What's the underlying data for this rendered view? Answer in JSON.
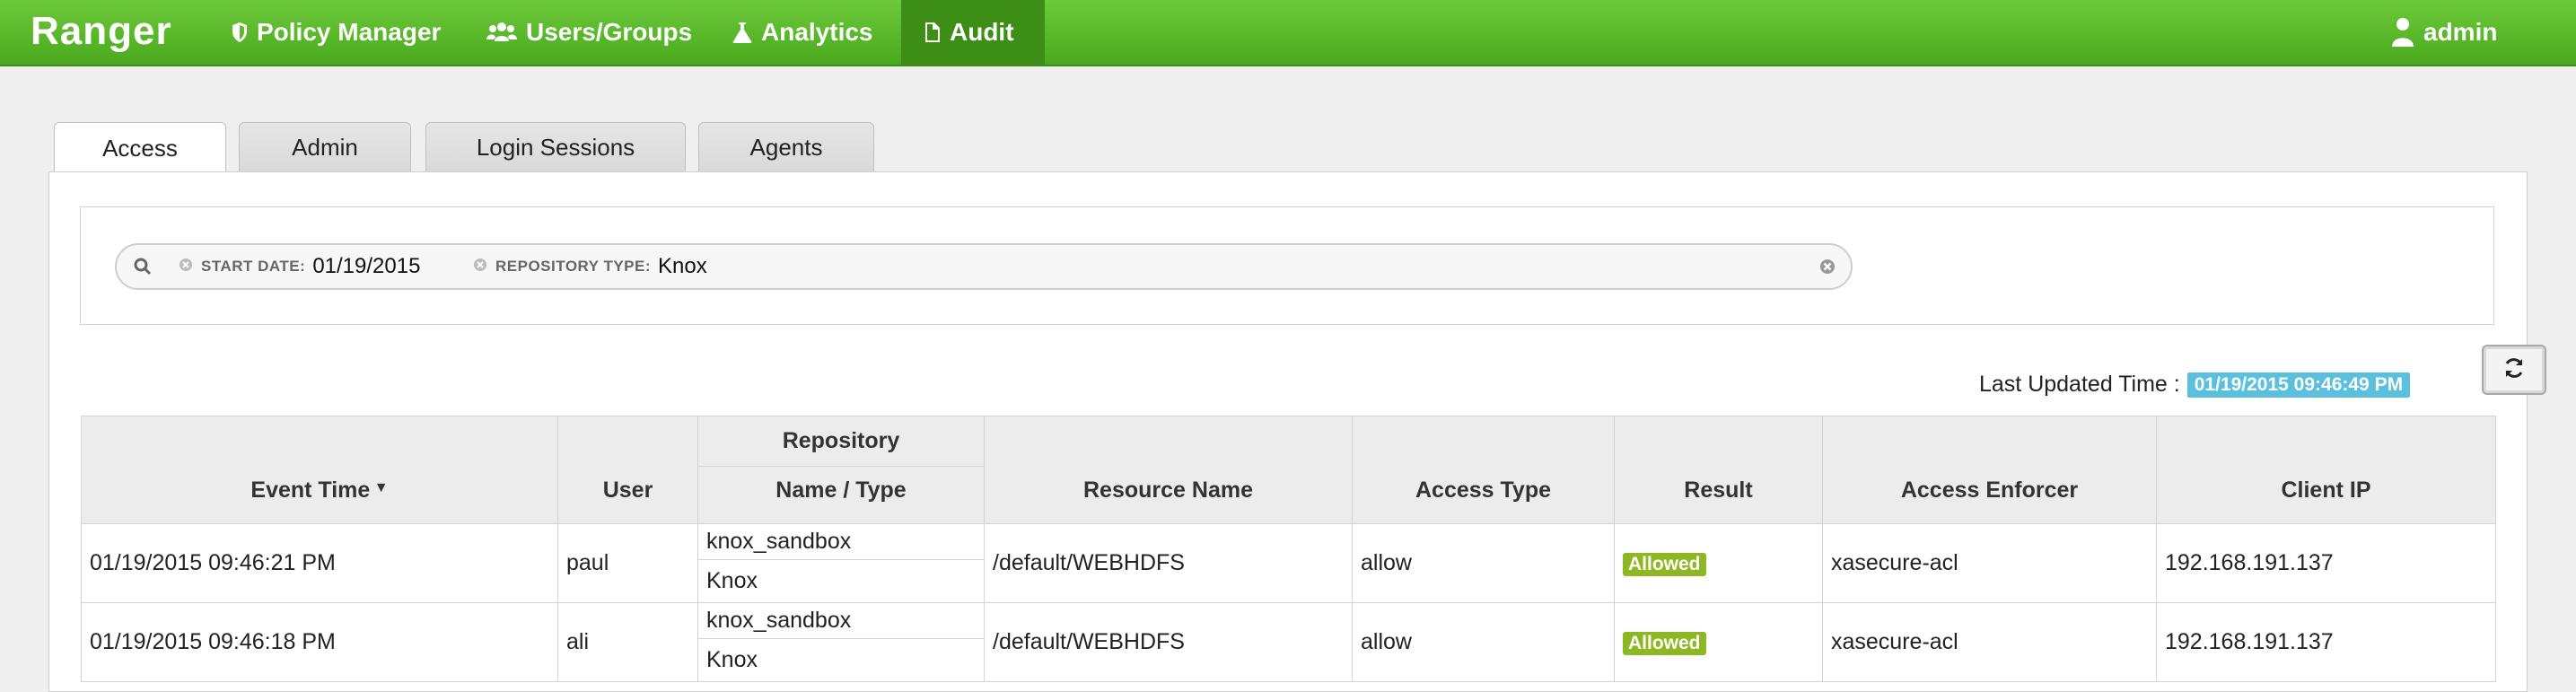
{
  "navbar": {
    "brand": "Ranger",
    "items": [
      {
        "label": "Policy Manager",
        "icon": "shield-icon"
      },
      {
        "label": "Users/Groups",
        "icon": "users-icon"
      },
      {
        "label": "Analytics",
        "icon": "flask-icon"
      },
      {
        "label": "Audit",
        "icon": "file-icon",
        "active": true
      }
    ],
    "user": {
      "label": "admin",
      "icon": "user-icon"
    }
  },
  "tabs": [
    {
      "label": "Access",
      "active": true
    },
    {
      "label": "Admin"
    },
    {
      "label": "Login Sessions"
    },
    {
      "label": "Agents"
    }
  ],
  "search": {
    "facets": [
      {
        "label": "START DATE:",
        "value": "01/19/2015"
      },
      {
        "label": "REPOSITORY TYPE:",
        "value": "Knox"
      }
    ]
  },
  "last_updated": {
    "label": "Last Updated Time :",
    "value": "01/19/2015 09:46:49 PM"
  },
  "table": {
    "group_header": "Repository",
    "columns": {
      "event_time": "Event Time",
      "user": "User",
      "repo": "Name / Type",
      "resource": "Resource Name",
      "access_type": "Access Type",
      "result": "Result",
      "enforcer": "Access Enforcer",
      "client_ip": "Client IP"
    },
    "rows": [
      {
        "event_time": "01/19/2015 09:46:21 PM",
        "user": "paul",
        "repo_name": "knox_sandbox",
        "repo_type": "Knox",
        "resource": "/default/WEBHDFS",
        "access_type": "allow",
        "result": "Allowed",
        "enforcer": "xasecure-acl",
        "client_ip": "192.168.191.137"
      },
      {
        "event_time": "01/19/2015 09:46:18 PM",
        "user": "ali",
        "repo_name": "knox_sandbox",
        "repo_type": "Knox",
        "resource": "/default/WEBHDFS",
        "access_type": "allow",
        "result": "Allowed",
        "enforcer": "xasecure-acl",
        "client_ip": "192.168.191.137"
      }
    ]
  },
  "colors": {
    "navbar": "#4aa91d",
    "active_nav": "#3c8e16",
    "time_badge": "#5bc0de",
    "allowed_badge": "#8db823"
  }
}
